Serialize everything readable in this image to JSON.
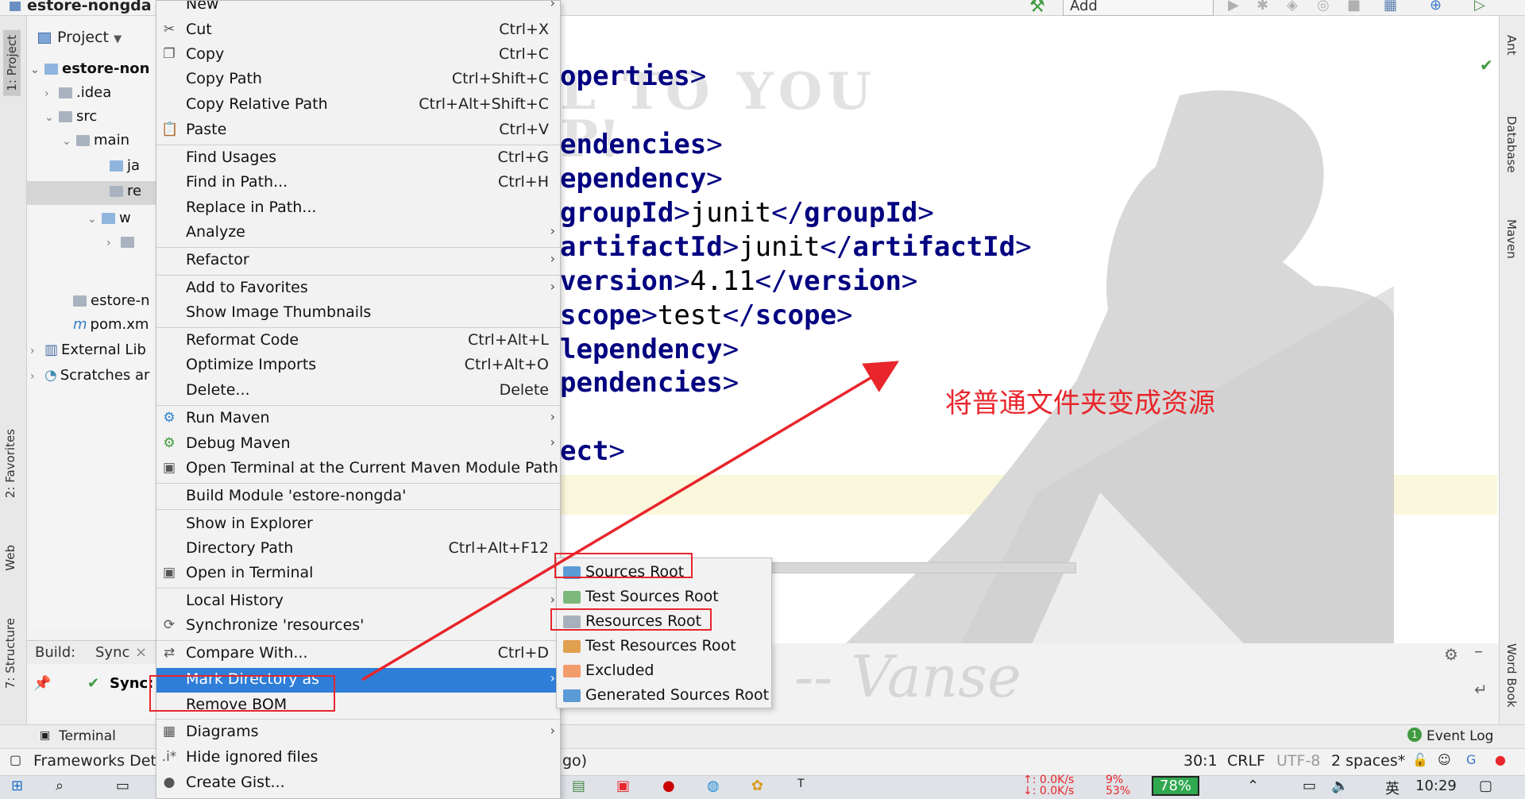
{
  "project": {
    "name": "estore-nongda",
    "panel_label": "Project",
    "tree": [
      {
        "label": "estore-non",
        "bold": true
      },
      {
        "label": ".idea"
      },
      {
        "label": "src"
      },
      {
        "label": "main"
      },
      {
        "label": "ja"
      },
      {
        "label": "re"
      },
      {
        "label": "w"
      },
      {
        "label": ""
      },
      {
        "label": "estore-n"
      },
      {
        "label": "pom.xm"
      },
      {
        "label": "External Lib"
      },
      {
        "label": "Scratches ar"
      }
    ]
  },
  "toolbar": {
    "add_configuration": "Add Configuration..."
  },
  "left_tabs": {
    "project": "1: Project",
    "favorites": "2: Favorites",
    "web": "Web",
    "structure": "7: Structure"
  },
  "right_tabs": {
    "ant": "Ant",
    "database": "Database",
    "maven": "Maven",
    "word_book": "Word Book"
  },
  "editor": {
    "lines": [
      {
        "pre": "",
        "tag": "operties",
        "post": ">"
      },
      {
        "pre": "",
        "tag": "endencies",
        "post": ">"
      },
      {
        "pre": "",
        "tag": "ependency",
        "post": ">"
      },
      {
        "pre": "",
        "tag": "groupId",
        "val": "junit",
        "close": "groupId"
      },
      {
        "pre": "",
        "tag": "artifactId",
        "val": "junit",
        "close": "artifactId"
      },
      {
        "pre": "",
        "tag": "version",
        "val": "4.11",
        "close": "version"
      },
      {
        "pre": "",
        "tag": "scope",
        "val": "test",
        "close": "scope"
      },
      {
        "pre": "",
        "tag": "lependency",
        "post": ">"
      },
      {
        "pre": "",
        "tag": "pendencies",
        "post": ">"
      },
      {
        "pre": "",
        "tag": "ect",
        "post": ">"
      }
    ],
    "bg_text1": "L TO YOU",
    "bg_text2": "P!",
    "signature": "-- Vanse",
    "annotation": "将普通文件夹变成资源"
  },
  "context_menu": {
    "items": [
      {
        "label": "New",
        "shortcut": "",
        "submenu": true
      },
      {
        "label": "Cut",
        "shortcut": "Ctrl+X",
        "icon": "✂"
      },
      {
        "label": "Copy",
        "shortcut": "Ctrl+C",
        "icon": "❐"
      },
      {
        "label": "Copy Path",
        "shortcut": "Ctrl+Shift+C"
      },
      {
        "label": "Copy Relative Path",
        "shortcut": "Ctrl+Alt+Shift+C"
      },
      {
        "label": "Paste",
        "shortcut": "Ctrl+V",
        "icon": "📋"
      },
      {
        "label": "Find Usages",
        "shortcut": "Ctrl+G"
      },
      {
        "label": "Find in Path...",
        "shortcut": "Ctrl+H"
      },
      {
        "label": "Replace in Path...",
        "shortcut": ""
      },
      {
        "label": "Analyze",
        "shortcut": "",
        "submenu": true
      },
      {
        "label": "Refactor",
        "shortcut": "",
        "submenu": true
      },
      {
        "label": "Add to Favorites",
        "shortcut": "",
        "submenu": true
      },
      {
        "label": "Show Image Thumbnails",
        "shortcut": ""
      },
      {
        "label": "Reformat Code",
        "shortcut": "Ctrl+Alt+L"
      },
      {
        "label": "Optimize Imports",
        "shortcut": "Ctrl+Alt+O"
      },
      {
        "label": "Delete...",
        "shortcut": "Delete"
      },
      {
        "label": "Run Maven",
        "shortcut": "",
        "submenu": true,
        "icon": "⚙"
      },
      {
        "label": "Debug Maven",
        "shortcut": "",
        "submenu": true,
        "icon": "⚙"
      },
      {
        "label": "Open Terminal at the Current Maven Module Path",
        "shortcut": "",
        "icon": "▣"
      },
      {
        "label": "Build Module 'estore-nongda'",
        "shortcut": ""
      },
      {
        "label": "Show in Explorer",
        "shortcut": ""
      },
      {
        "label": "Directory Path",
        "shortcut": "Ctrl+Alt+F12"
      },
      {
        "label": "Open in Terminal",
        "shortcut": "",
        "icon": "▣"
      },
      {
        "label": "Local History",
        "shortcut": "",
        "submenu": true
      },
      {
        "label": "Synchronize 'resources'",
        "shortcut": "",
        "icon": "⟳"
      },
      {
        "label": "Compare With...",
        "shortcut": "Ctrl+D",
        "icon": "⇄"
      },
      {
        "label": "Mark Directory as",
        "shortcut": "",
        "submenu": true,
        "active": true
      },
      {
        "label": "Remove BOM",
        "shortcut": ""
      },
      {
        "label": "Diagrams",
        "shortcut": "",
        "submenu": true,
        "icon": "▦"
      },
      {
        "label": "Hide ignored files",
        "shortcut": "",
        "icon": ".i*"
      },
      {
        "label": "Create Gist...",
        "shortcut": "",
        "icon": "●"
      }
    ]
  },
  "submenu": {
    "items": [
      {
        "label": "Sources Root",
        "color": "#5b9bd5"
      },
      {
        "label": "Test Sources Root",
        "color": "#7cb87c"
      },
      {
        "label": "Resources Root",
        "color": "#a7b0bb"
      },
      {
        "label": "Test Resources Root",
        "color": "#e0a050"
      },
      {
        "label": "Excluded",
        "color": "#f29b6b"
      },
      {
        "label": "Generated Sources Root",
        "color": "#5b9bd5"
      }
    ]
  },
  "build_panel": {
    "build_label": "Build:",
    "sync_tab": "Sync",
    "sync_item": "Sync:"
  },
  "bottom_toolbar": {
    "terminal": "Terminal",
    "event_log": "Event Log",
    "event_count": "1"
  },
  "statusbar": {
    "frameworks": "Frameworks Dete",
    "ago": "go)",
    "position": "30:1",
    "line_sep": "CRLF",
    "encoding": "UTF-8",
    "indent": "2 spaces*"
  },
  "taskbar": {
    "net_up": "↑: 0.0K/s",
    "net_down": "↓: 0.0K/s",
    "cpu": "9%",
    "cpu2": "53%",
    "battery": "78%",
    "ime": "英",
    "time": "10:29"
  }
}
